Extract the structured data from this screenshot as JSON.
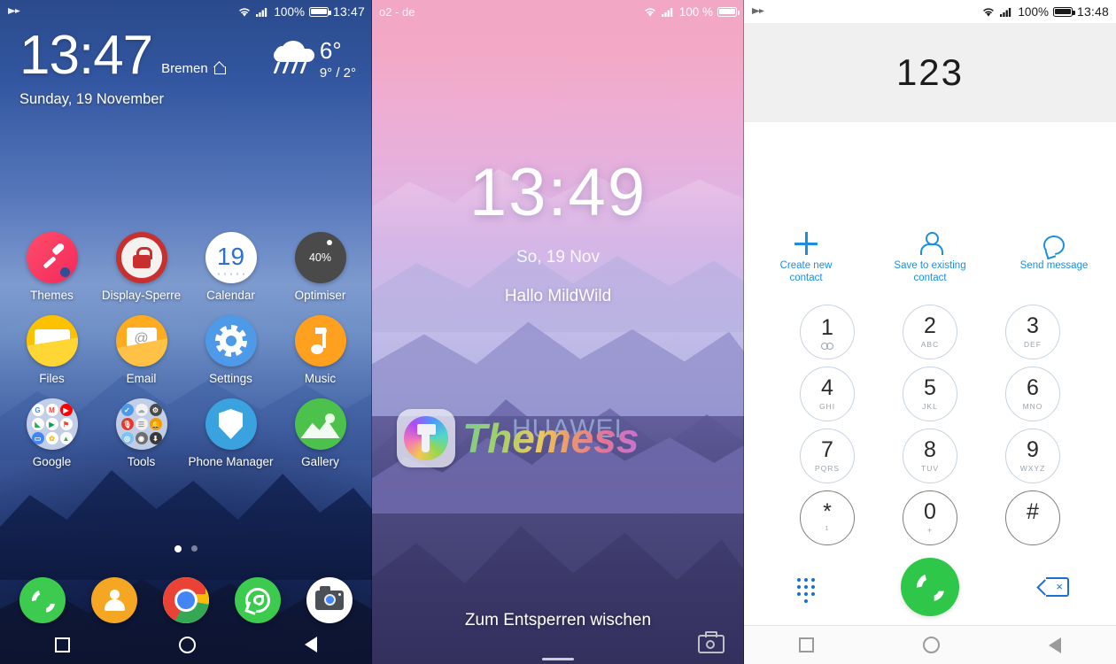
{
  "home": {
    "status": {
      "left_icon": "double-chevron-right-icon",
      "wifi": "wifi-icon",
      "signal": "signal-bars-icon",
      "battery_pct": "100%",
      "battery": "battery-full-icon",
      "time": "13:47"
    },
    "widget": {
      "clock": "13:47",
      "city": "Bremen",
      "home_icon": "home-outline-icon",
      "date": "Sunday, 19 November"
    },
    "weather": {
      "icon": "rain-cloud-icon",
      "current_temp": "6°",
      "range": "9° / 2°"
    },
    "apps": [
      {
        "label": "Themes",
        "icon": "paint-brush-icon"
      },
      {
        "label": "Display-Sperre",
        "icon": "padlock-icon"
      },
      {
        "label": "Calendar",
        "icon": "calendar-icon",
        "day": "19"
      },
      {
        "label": "Optimiser",
        "icon": "optimiser-icon",
        "value": "40%"
      },
      {
        "label": "Files",
        "icon": "folder-icon"
      },
      {
        "label": "Email",
        "icon": "envelope-at-icon"
      },
      {
        "label": "Settings",
        "icon": "gear-icon"
      },
      {
        "label": "Music",
        "icon": "music-note-icon"
      },
      {
        "label": "Google",
        "icon": "google-folder-icon"
      },
      {
        "label": "Tools",
        "icon": "tools-folder-icon"
      },
      {
        "label": "Phone Manager",
        "icon": "shield-icon"
      },
      {
        "label": "Gallery",
        "icon": "landscape-photo-icon"
      }
    ],
    "page_dots": {
      "count": 2,
      "active": 1
    },
    "dock": [
      {
        "name": "phone-app",
        "icon": "phone-handset-icon"
      },
      {
        "name": "contacts-app",
        "icon": "person-icon"
      },
      {
        "name": "chrome-app",
        "icon": "chrome-icon"
      },
      {
        "name": "whatsapp-app",
        "icon": "whatsapp-icon"
      },
      {
        "name": "camera-app",
        "icon": "camera-icon"
      }
    ],
    "nav": [
      {
        "name": "recents-button",
        "icon": "square-icon"
      },
      {
        "name": "home-button",
        "icon": "circle-icon"
      },
      {
        "name": "back-button",
        "icon": "triangle-left-icon"
      }
    ]
  },
  "lockscreen": {
    "status": {
      "carrier": "o2 - de",
      "wifi": "wifi-icon",
      "signal": "signal-bars-icon",
      "battery_pct": "100 %",
      "battery": "battery-full-icon"
    },
    "clock": "13:49",
    "date": "So, 19 Nov",
    "greeting": "Hallo MildWild",
    "watermark": {
      "badge_icon": "themes-brush-badge-icon",
      "brand": "HUAWEI",
      "wordmark": "Themess"
    },
    "swipe_hint": "Zum Entsperren wischen",
    "camera_shortcut": "camera-icon",
    "home_indicator": "home-bar-indicator"
  },
  "dialer": {
    "status": {
      "left_icon": "double-chevron-right-icon",
      "wifi": "wifi-icon",
      "signal": "signal-bars-icon",
      "battery_pct": "100%",
      "battery": "battery-full-icon",
      "time": "13:48"
    },
    "number": "123",
    "accent": "#1a8fe0",
    "actions": [
      {
        "label": "Create new contact",
        "icon": "plus-icon"
      },
      {
        "label": "Save to existing contact",
        "icon": "person-outline-icon"
      },
      {
        "label": "Send message",
        "icon": "speech-bubble-icon"
      }
    ],
    "keys": [
      {
        "num": "1",
        "sub": "",
        "vm": true
      },
      {
        "num": "2",
        "sub": "ABC"
      },
      {
        "num": "3",
        "sub": "DEF"
      },
      {
        "num": "4",
        "sub": "GHI"
      },
      {
        "num": "5",
        "sub": "JKL"
      },
      {
        "num": "6",
        "sub": "MNO"
      },
      {
        "num": "7",
        "sub": "PQRS"
      },
      {
        "num": "8",
        "sub": "TUV"
      },
      {
        "num": "9",
        "sub": "WXYZ"
      },
      {
        "num": "*",
        "sub": "1",
        "dark": true
      },
      {
        "num": "0",
        "sub": "+",
        "dark": true
      },
      {
        "num": "#",
        "sub": "",
        "dark": true
      }
    ],
    "bottom": [
      {
        "name": "keypad-toggle-button",
        "icon": "keypad-dots-icon"
      },
      {
        "name": "call-button",
        "icon": "phone-handset-icon",
        "color": "#2fc74a"
      },
      {
        "name": "backspace-button",
        "icon": "backspace-icon"
      }
    ],
    "nav": [
      {
        "name": "recents-button",
        "icon": "square-icon"
      },
      {
        "name": "home-button",
        "icon": "circle-icon"
      },
      {
        "name": "back-button",
        "icon": "triangle-left-icon"
      }
    ]
  }
}
